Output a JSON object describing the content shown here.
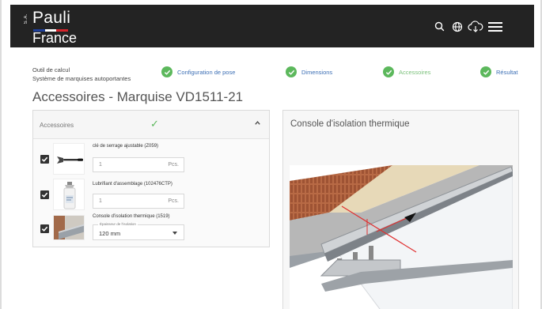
{
  "brand": {
    "prefix": "S.A.",
    "name": "Pauli",
    "country": "France",
    "flag_colors": [
      "#1e3f9a",
      "#ffffff",
      "#d6242b"
    ]
  },
  "header_icons": [
    {
      "name": "search-icon"
    },
    {
      "name": "globe-icon"
    },
    {
      "name": "cloud-download-icon"
    },
    {
      "name": "menu-icon"
    }
  ],
  "tool": {
    "line1": "Outil de calcul",
    "line2": "Système de marquises autoportantes"
  },
  "steps": [
    {
      "label": "Configuration de pose",
      "status": "done",
      "color": "#3c6fb5"
    },
    {
      "label": "Dimensions",
      "status": "done",
      "color": "#3c6fb5"
    },
    {
      "label": "Accessoires",
      "status": "current",
      "color": "#7cc17c"
    },
    {
      "label": "Résultat",
      "status": "done",
      "color": "#3c6fb5"
    }
  ],
  "page_title": "Accessoires - Marquise VD1511-21",
  "accessories": {
    "title": "Accessoires",
    "status_icon": "check-icon",
    "items": [
      {
        "name": "clé de serrage ajustable (Z059)",
        "quantity": "1",
        "unit": "Pcs.",
        "checked": true
      },
      {
        "name": "Lubrifiant d'assemblage (102476CTP)",
        "quantity": "1",
        "unit": "Pcs.",
        "checked": true
      },
      {
        "name": "Console d'isolation thermique (1519)",
        "select_label": "Épaisseur de l'isolation",
        "select_value": "120 mm",
        "checked": true
      }
    ]
  },
  "preview": {
    "title": "Console d'isolation thermique"
  },
  "colors": {
    "header_bg": "#232323",
    "success": "#5cb85c",
    "link": "#3c6fb5",
    "current_step": "#7cc17c"
  }
}
